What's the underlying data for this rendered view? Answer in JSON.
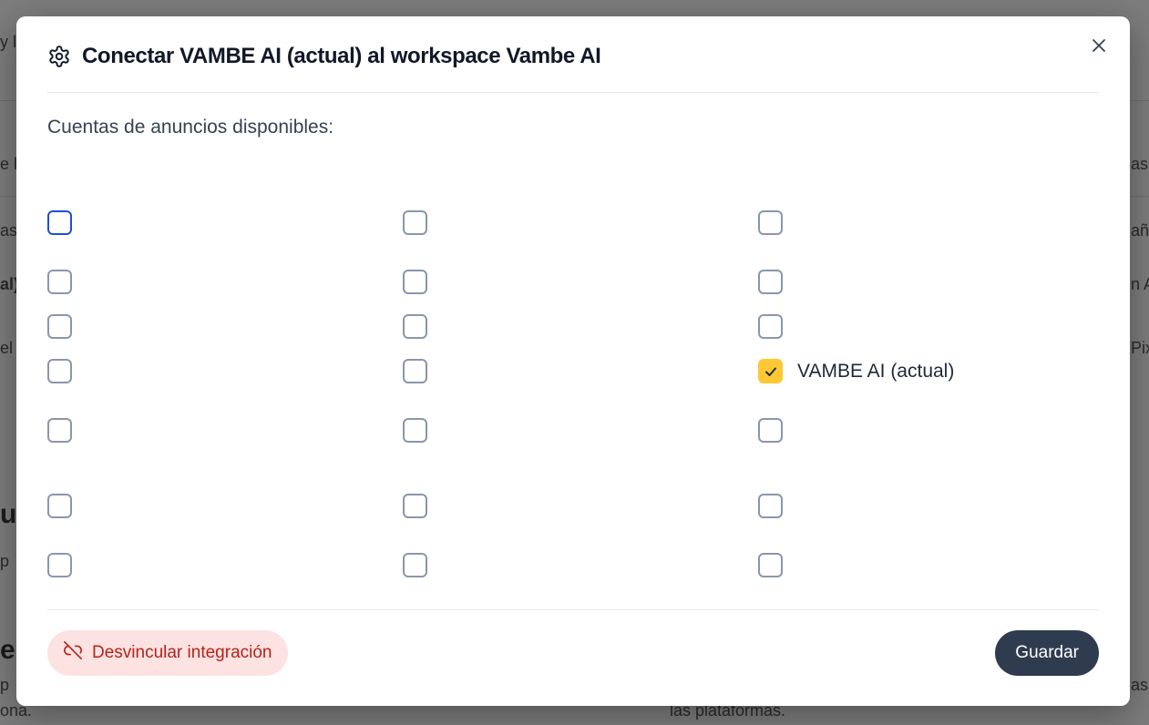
{
  "background": {
    "fragments": [
      "y l",
      "e l",
      "as",
      "al)",
      "el",
      "ui",
      "p",
      "e C",
      "p",
      "ona.",
      "as",
      "aña",
      "n A",
      "Pix",
      "as",
      "las plataformas."
    ]
  },
  "modal": {
    "title": "Conectar VAMBE AI (actual) al workspace Vambe AI",
    "title_icon": "gear-icon",
    "close_icon": "close-icon",
    "section_label": "Cuentas de anuncios disponibles:",
    "checkbox_rows": [
      [
        {
          "label": "",
          "checked": false,
          "focused": true
        },
        {
          "label": "",
          "checked": false
        },
        {
          "label": "",
          "checked": false
        }
      ],
      [
        {
          "label": "",
          "checked": false
        },
        {
          "label": "",
          "checked": false
        },
        {
          "label": "",
          "checked": false
        }
      ],
      [
        {
          "label": "",
          "checked": false
        },
        {
          "label": "",
          "checked": false
        },
        {
          "label": "",
          "checked": false
        }
      ],
      [
        {
          "label": "",
          "checked": false
        },
        {
          "label": "",
          "checked": false
        },
        {
          "label": "VAMBE AI (actual)",
          "checked": true
        }
      ],
      [
        {
          "label": "",
          "checked": false
        },
        {
          "label": "",
          "checked": false
        },
        {
          "label": "",
          "checked": false
        }
      ],
      [
        {
          "label": "",
          "checked": false
        },
        {
          "label": "",
          "checked": false
        },
        {
          "label": "",
          "checked": false
        }
      ],
      [
        {
          "label": "",
          "checked": false
        },
        {
          "label": "",
          "checked": false
        },
        {
          "label": "",
          "checked": false
        }
      ]
    ],
    "unlink_button": {
      "label": "Desvincular integración",
      "icon": "unlink-icon"
    },
    "save_button": {
      "label": "Guardar"
    },
    "colors": {
      "checked": "#fcc934",
      "focused_border": "#1d4ed8",
      "unlink_bg": "#fde2e2",
      "unlink_text": "#b42318",
      "save_bg": "#2f3b4e"
    }
  }
}
